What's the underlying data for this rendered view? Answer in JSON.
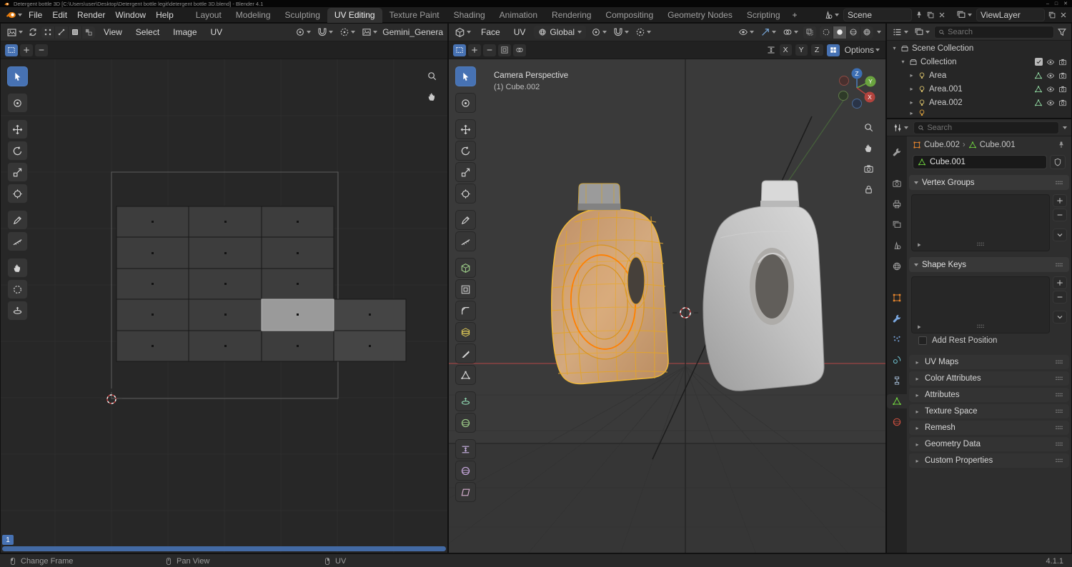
{
  "window": {
    "title": "Detergent bottle 3D [C:\\Users\\user\\Desktop\\Detergent bottle legit\\detergent bottle 3D.blend] - Blender 4.1"
  },
  "topbar": {
    "menus": [
      "File",
      "Edit",
      "Render",
      "Window",
      "Help"
    ],
    "tabs": [
      "Layout",
      "Modeling",
      "Sculpting",
      "UV Editing",
      "Texture Paint",
      "Shading",
      "Animation",
      "Rendering",
      "Compositing",
      "Geometry Nodes",
      "Scripting"
    ],
    "add_tab": "+",
    "scene": "Scene",
    "view_layer": "ViewLayer"
  },
  "uv_editor": {
    "menu_view": "View",
    "menu_select": "Select",
    "menu_image": "Image",
    "menu_uv": "UV",
    "image_name": "Gemini_Genera",
    "frame_badge": "1"
  },
  "viewport": {
    "menu_face": "Face",
    "menu_uv": "UV",
    "orientation": "Global",
    "overlay_title": "Camera Perspective",
    "overlay_object": "(1) Cube.002",
    "axis_x": "X",
    "axis_y": "Y",
    "axis_z": "Z",
    "options": "Options",
    "gizmo": {
      "x": "X",
      "y": "Y",
      "z": "Z"
    }
  },
  "outliner": {
    "search_placeholder": "Search",
    "root": "Scene Collection",
    "collection": "Collection",
    "lights": [
      "Area",
      "Area.001",
      "Area.002"
    ]
  },
  "properties": {
    "search_placeholder": "Search",
    "breadcrumb_object": "Cube.002",
    "breadcrumb_separator": "›",
    "breadcrumb_data": "Cube.001",
    "name_value": "Cube.001",
    "panel_vertex_groups": "Vertex Groups",
    "panel_shape_keys": "Shape Keys",
    "add_rest_position": "Add Rest Position",
    "panel_uv_maps": "UV Maps",
    "panel_color_attributes": "Color Attributes",
    "panel_attributes": "Attributes",
    "panel_texture_space": "Texture Space",
    "panel_remesh": "Remesh",
    "panel_geometry_data": "Geometry Data",
    "panel_custom_properties": "Custom Properties"
  },
  "status_bar": {
    "change_frame": "Change Frame",
    "pan_view": "Pan View",
    "uv": "UV",
    "version": "4.1.1"
  },
  "colors": {
    "accent_blue": "#4772b3",
    "selection_orange": "#ff8a00",
    "wireframe_yellow": "#e8b83a",
    "object_orange": "#e87d0d",
    "data_green": "#6fcf3f",
    "material_red": "#cf5040"
  }
}
